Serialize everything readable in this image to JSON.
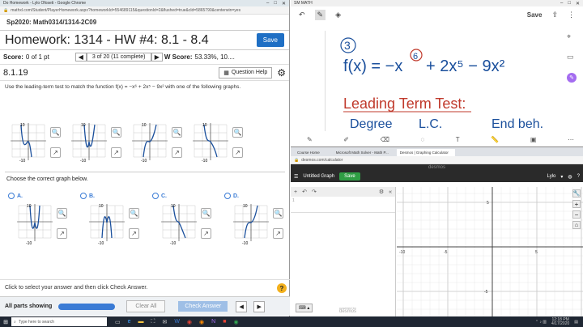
{
  "left_window": {
    "title": "Do Homework - Lylo Ofoseti - Google Chrome",
    "url": "mathxl.com/Student/PlayerHomework.aspx?homeworkId=554689115&questionId=2&flushed=true&cld=5865790&centerwin=yes",
    "course": "Sp2020: Math0314/1314-2C09",
    "hw_title": "Homework: 1314 - HW #4: 8.1 - 8.4",
    "save": "Save",
    "score_label": "Score:",
    "score_value": "0 of 1 pt",
    "progress": "3 of 20 (11 complete)",
    "hw_score_label": "W Score:",
    "hw_score_value": "53.33%, 10....",
    "question_id": "8.1.19",
    "question_help": "Question Help",
    "instructions": "Use the leading-term test to match the function f(x) = −x⁶ + 2x⁵ − 9x² with one of the following graphs.",
    "choose": "Choose the correct graph below.",
    "options": [
      "A.",
      "B.",
      "C.",
      "D."
    ],
    "tick_labels": {
      "pos": "10",
      "neg": "-10"
    },
    "footer_text": "Click to select your answer and then click Check Answer.",
    "all_parts": "All parts showing",
    "clear_all": "Clear All",
    "check_answer": "Check Answer",
    "help_glyph": "?"
  },
  "notes": {
    "save": "Save",
    "tab_label": "SM MATH",
    "circled_number": "3",
    "function_text": "f(x) = −x",
    "exp_circled": "6",
    "function_rest": "+ 2x⁵ − 9x²",
    "heading": "Leading Term Test:",
    "col1": "Degree",
    "col2": "L.C.",
    "col3": "End beh."
  },
  "desmos": {
    "tabs": [
      "Course Home",
      "Microsoft Math Solver - Math P...",
      "Desmos | Graphing Calculator"
    ],
    "url": "desmos.com/calculator",
    "logo": "desmos",
    "graph_title": "Untitled Graph",
    "save": "Save",
    "user": "Lylo",
    "x_ticks": [
      "-10",
      "-5",
      "5"
    ],
    "y_ticks": [
      "5",
      "-5"
    ],
    "powered_by": "powered by",
    "powered_logo": "desmos"
  },
  "taskbar": {
    "search": "Type here to search",
    "time": "12:18 PM",
    "date": "4/17/2020"
  },
  "colors": {
    "accent_blue": "#3a7bd5",
    "desmos_green": "#2f9e44",
    "ink_blue": "#1a4f9c",
    "ink_red": "#c0392b"
  }
}
